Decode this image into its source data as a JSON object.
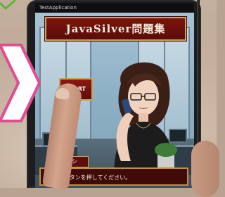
{
  "statusbar": {
    "app_title": "TestApplication"
  },
  "title_banner": {
    "text": "JavaSilver問題集"
  },
  "start_button": {
    "label": "START"
  },
  "nameplate": {
    "name": "バヤシ"
  },
  "dialog": {
    "text": "STARTボタンを押してください。"
  },
  "colors": {
    "accent_red": "#7a1410",
    "gold_border": "#c9a35a",
    "arrow_pink": "#e24c92",
    "check_green": "#5fb437"
  }
}
